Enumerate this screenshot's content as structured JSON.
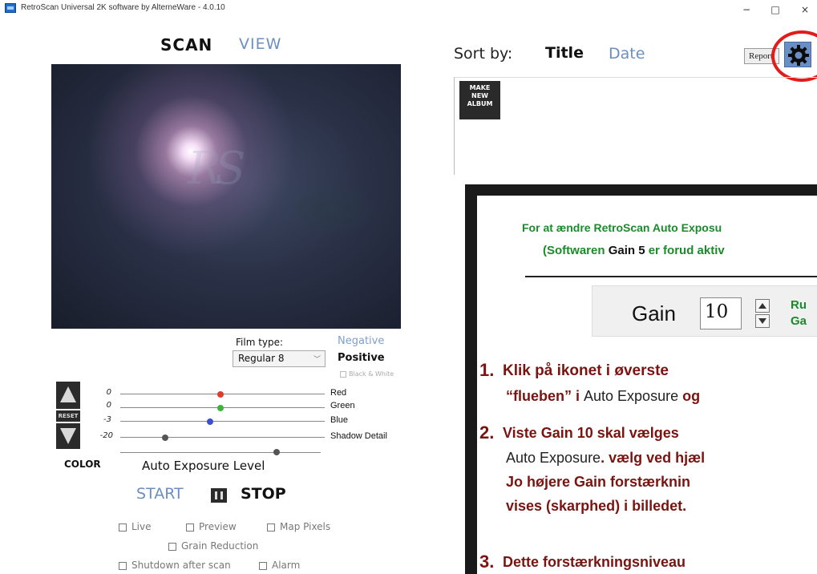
{
  "window": {
    "title": "RetroScan Universal 2K software by AlterneWare - 4.0.10",
    "minimize_glyph": "−",
    "maximize_glyph": "□",
    "close_glyph": "×"
  },
  "left": {
    "tabs": {
      "scan": "SCAN",
      "view": "VIEW"
    },
    "preview_logo": "RS",
    "film_type_label": "Film type:",
    "film_type_value": "Regular 8",
    "film_options": {
      "negative": "Negative",
      "positive": "Positive",
      "black_white": "Black & White"
    },
    "reset_label": "RESET",
    "sliders": [
      {
        "label": "Red",
        "value": "0",
        "level": 0.49,
        "color": "#e23b2e"
      },
      {
        "label": "Green",
        "value": "0",
        "level": 0.49,
        "color": "#38b53a"
      },
      {
        "label": "Blue",
        "value": "-3",
        "level": 0.44,
        "color": "#3b4fd0"
      },
      {
        "label": "Shadow Detail",
        "value": "-20",
        "level": 0.22,
        "color": "#555555"
      }
    ],
    "color_label": "COLOR",
    "auto_exposure_label": "Auto Exposure Level",
    "auto_exposure_level": 0.78,
    "start_label": "START",
    "stop_label": "STOP",
    "checkboxes": {
      "live": "Live",
      "preview": "Preview",
      "map_pixels": "Map Pixels",
      "grain_reduction": "Grain Reduction",
      "shutdown": "Shutdown after scan",
      "alarm": "Alarm"
    }
  },
  "right": {
    "sort_label": "Sort by:",
    "sort_title": "Title",
    "sort_date": "Date",
    "report_label": "Report",
    "make_album": [
      "MAKE",
      "NEW",
      "ALBUM"
    ]
  },
  "overlay": {
    "heading1": "For at ændre RetroScan Auto Exposu",
    "heading2_a": "(Softwaren ",
    "heading2_b": "Gain 5",
    "heading2_c": " er forud aktiv",
    "gain_label": "Gain",
    "gain_value": "10",
    "gain_side_1": "Ru",
    "gain_side_2": "Ga",
    "step1_num": "1.",
    "step1_line1": "Klik på ikonet i øverste",
    "step1_line2_a": "“flueben” i ",
    "step1_line2_b": "Auto Exposure",
    "step1_line2_c": " og",
    "step2_num": "2.",
    "step2_line1": "Viste Gain 10 skal vælges",
    "step2_line2_a": "Auto Exposure",
    "step2_line2_b": ". vælg ved hjæl",
    "step2_line3": "Jo højere Gain forstærknin",
    "step2_line4": "vises (skarphed) i billedet.",
    "step3_num": "3.",
    "step3_line1": "Dette forstærkningsniveau"
  }
}
